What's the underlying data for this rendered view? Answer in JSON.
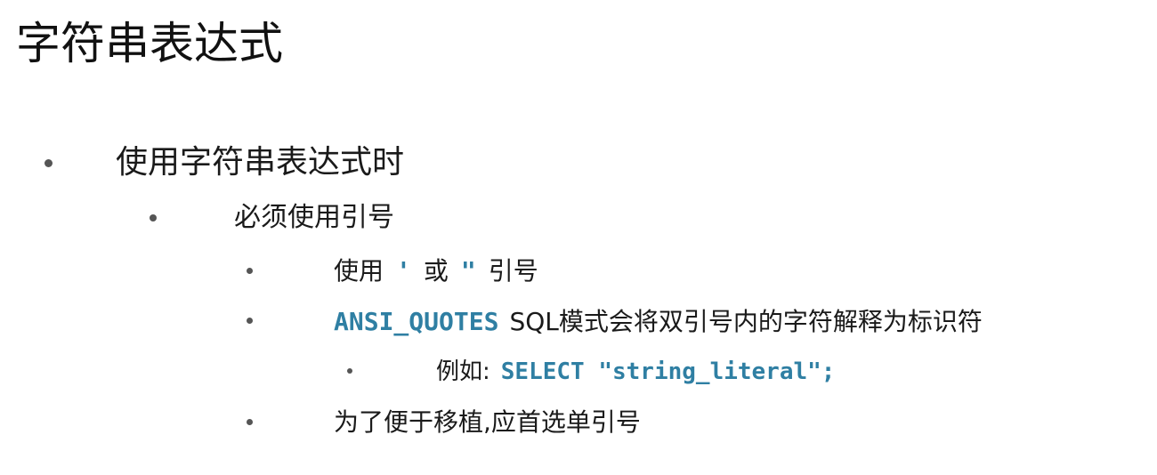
{
  "title": "字符串表达式",
  "bullets": {
    "b1": {
      "text": "使用字符串表达式时"
    },
    "b2": {
      "text": "必须使用引号"
    },
    "b3": {
      "prefix": "使用",
      "quote1": "'",
      "middle": "或",
      "quote2": "\"",
      "suffix": "引号"
    },
    "b4": {
      "code": "ANSI_QUOTES",
      "text": "SQL模式会将双引号内的字符解释为标识符"
    },
    "b5": {
      "prefix": "例如:",
      "code": "SELECT \"string_literal\";"
    },
    "b6": {
      "text": "为了便于移植,应首选单引号"
    }
  }
}
